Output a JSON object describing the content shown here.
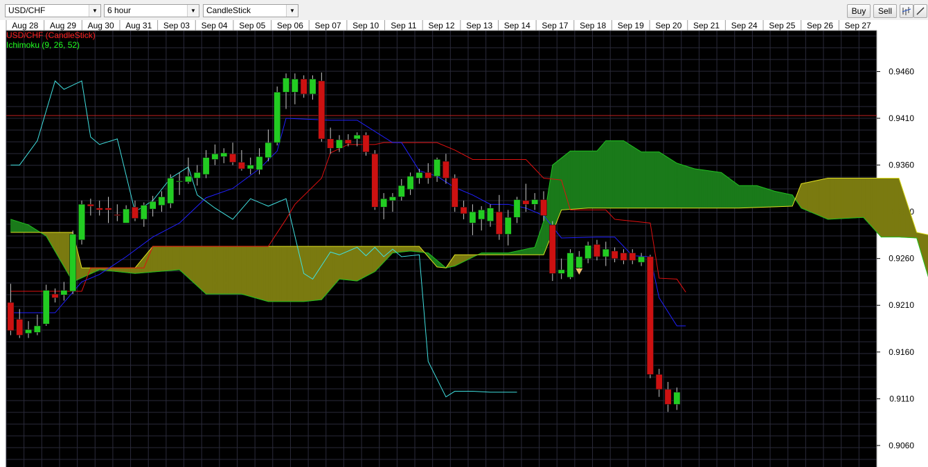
{
  "toolbar": {
    "symbol": "USD/CHF",
    "timeframe": "6 hour",
    "chart_type": "CandleStick",
    "buy_label": "Buy",
    "sell_label": "Sell",
    "icons": [
      "indicator-icon",
      "draw-line-icon"
    ]
  },
  "legend": {
    "main": "USD/CHF (CandleStick)",
    "main_color": "#ff2020",
    "indicator": "Ichimoku (9, 26, 52)",
    "indicator_color": "#20ff20"
  },
  "colors": {
    "background": "#000000",
    "grid": "#2a2a3a",
    "bull": "#22cc22",
    "bear": "#cc1111",
    "tenkan": "#2020ff",
    "kijun": "#e01010",
    "chikou": "#40e0e0",
    "span_a": "#20c020",
    "span_b": "#e0e020",
    "cloud_bull": "#1a7a1a",
    "cloud_bear": "#7a7a10",
    "hline": "#c02020"
  },
  "chart_data": {
    "type": "candlestick",
    "title": "",
    "x_labels": [
      "Aug 28",
      "Aug 29",
      "Aug 30",
      "Aug 31",
      "Sep 03",
      "Sep 04",
      "Sep 05",
      "Sep 06",
      "Sep 07",
      "Sep 10",
      "Sep 11",
      "Sep 12",
      "Sep 13",
      "Sep 14",
      "Sep 17",
      "Sep 18",
      "Sep 19",
      "Sep 20",
      "Sep 21",
      "Sep 24",
      "Sep 25",
      "Sep 26",
      "Sep 27"
    ],
    "y_ticks": [
      "0.9460",
      "0.9410",
      "0.9360",
      "0.9310",
      "0.9260",
      "0.9210",
      "0.9160",
      "0.9110",
      "0.9060"
    ],
    "ylim": [
      0.9037,
      0.9504
    ],
    "x_slots": 98,
    "horizontal_line": 0.9413,
    "candles": [
      {
        "o": 0.9213,
        "h": 0.9233,
        "l": 0.9178,
        "c": 0.9183
      },
      {
        "o": 0.9195,
        "h": 0.9206,
        "l": 0.9175,
        "c": 0.9178
      },
      {
        "o": 0.918,
        "h": 0.9193,
        "l": 0.9175,
        "c": 0.9184
      },
      {
        "o": 0.9181,
        "h": 0.92,
        "l": 0.9178,
        "c": 0.9188
      },
      {
        "o": 0.919,
        "h": 0.9232,
        "l": 0.9188,
        "c": 0.9226
      },
      {
        "o": 0.9222,
        "h": 0.9228,
        "l": 0.9213,
        "c": 0.9218
      },
      {
        "o": 0.9221,
        "h": 0.9235,
        "l": 0.9215,
        "c": 0.9226
      },
      {
        "o": 0.9225,
        "h": 0.929,
        "l": 0.9222,
        "c": 0.9286
      },
      {
        "o": 0.928,
        "h": 0.9322,
        "l": 0.9275,
        "c": 0.9318
      },
      {
        "o": 0.9318,
        "h": 0.9324,
        "l": 0.9306,
        "c": 0.9316
      },
      {
        "o": 0.9314,
        "h": 0.9322,
        "l": 0.9306,
        "c": 0.9312
      },
      {
        "o": 0.9314,
        "h": 0.9326,
        "l": 0.9298,
        "c": 0.9312
      },
      {
        "o": 0.9307,
        "h": 0.9318,
        "l": 0.93,
        "c": 0.9306
      },
      {
        "o": 0.9298,
        "h": 0.9317,
        "l": 0.9298,
        "c": 0.9313
      },
      {
        "o": 0.9315,
        "h": 0.9322,
        "l": 0.93,
        "c": 0.9303
      },
      {
        "o": 0.9302,
        "h": 0.932,
        "l": 0.9294,
        "c": 0.9317
      },
      {
        "o": 0.9313,
        "h": 0.9327,
        "l": 0.9305,
        "c": 0.9321
      },
      {
        "o": 0.9317,
        "h": 0.9332,
        "l": 0.931,
        "c": 0.9326
      },
      {
        "o": 0.9319,
        "h": 0.935,
        "l": 0.9314,
        "c": 0.9346
      },
      {
        "o": 0.9342,
        "h": 0.9352,
        "l": 0.9328,
        "c": 0.9343
      },
      {
        "o": 0.9342,
        "h": 0.9368,
        "l": 0.934,
        "c": 0.9348
      },
      {
        "o": 0.9346,
        "h": 0.936,
        "l": 0.9338,
        "c": 0.9352
      },
      {
        "o": 0.935,
        "h": 0.9376,
        "l": 0.9346,
        "c": 0.9368
      },
      {
        "o": 0.9366,
        "h": 0.9382,
        "l": 0.936,
        "c": 0.9372
      },
      {
        "o": 0.9369,
        "h": 0.9378,
        "l": 0.9362,
        "c": 0.9373
      },
      {
        "o": 0.9372,
        "h": 0.9384,
        "l": 0.936,
        "c": 0.9363
      },
      {
        "o": 0.9363,
        "h": 0.9376,
        "l": 0.9354,
        "c": 0.9356
      },
      {
        "o": 0.9356,
        "h": 0.9368,
        "l": 0.935,
        "c": 0.936
      },
      {
        "o": 0.9355,
        "h": 0.9378,
        "l": 0.935,
        "c": 0.9369
      },
      {
        "o": 0.9368,
        "h": 0.9398,
        "l": 0.9364,
        "c": 0.9384
      },
      {
        "o": 0.9384,
        "h": 0.9444,
        "l": 0.9381,
        "c": 0.9438
      },
      {
        "o": 0.9438,
        "h": 0.9458,
        "l": 0.942,
        "c": 0.9453
      },
      {
        "o": 0.9438,
        "h": 0.9458,
        "l": 0.9425,
        "c": 0.9452
      },
      {
        "o": 0.9452,
        "h": 0.9456,
        "l": 0.9432,
        "c": 0.9436
      },
      {
        "o": 0.9436,
        "h": 0.9456,
        "l": 0.943,
        "c": 0.9452
      },
      {
        "o": 0.945,
        "h": 0.9459,
        "l": 0.9385,
        "c": 0.9388
      },
      {
        "o": 0.9388,
        "h": 0.94,
        "l": 0.9372,
        "c": 0.9378
      },
      {
        "o": 0.9378,
        "h": 0.9392,
        "l": 0.9374,
        "c": 0.9387
      },
      {
        "o": 0.9387,
        "h": 0.9393,
        "l": 0.938,
        "c": 0.9383
      },
      {
        "o": 0.9388,
        "h": 0.9395,
        "l": 0.938,
        "c": 0.9392
      },
      {
        "o": 0.9392,
        "h": 0.9395,
        "l": 0.937,
        "c": 0.9374
      },
      {
        "o": 0.9372,
        "h": 0.9376,
        "l": 0.9312,
        "c": 0.9315
      },
      {
        "o": 0.9315,
        "h": 0.933,
        "l": 0.9302,
        "c": 0.9324
      },
      {
        "o": 0.9322,
        "h": 0.933,
        "l": 0.931,
        "c": 0.9326
      },
      {
        "o": 0.9326,
        "h": 0.9345,
        "l": 0.9322,
        "c": 0.9338
      },
      {
        "o": 0.9334,
        "h": 0.9352,
        "l": 0.9328,
        "c": 0.9348
      },
      {
        "o": 0.9346,
        "h": 0.9356,
        "l": 0.934,
        "c": 0.9352
      },
      {
        "o": 0.9352,
        "h": 0.9362,
        "l": 0.934,
        "c": 0.9346
      },
      {
        "o": 0.9348,
        "h": 0.9368,
        "l": 0.9342,
        "c": 0.9366
      },
      {
        "o": 0.9364,
        "h": 0.9372,
        "l": 0.934,
        "c": 0.9346
      },
      {
        "o": 0.9346,
        "h": 0.935,
        "l": 0.931,
        "c": 0.9315
      },
      {
        "o": 0.9315,
        "h": 0.9322,
        "l": 0.9302,
        "c": 0.9308
      },
      {
        "o": 0.9298,
        "h": 0.9318,
        "l": 0.9285,
        "c": 0.931
      },
      {
        "o": 0.9302,
        "h": 0.9316,
        "l": 0.929,
        "c": 0.9312
      },
      {
        "o": 0.93,
        "h": 0.9318,
        "l": 0.9294,
        "c": 0.9314
      },
      {
        "o": 0.931,
        "h": 0.9328,
        "l": 0.928,
        "c": 0.9286
      },
      {
        "o": 0.9286,
        "h": 0.9312,
        "l": 0.9274,
        "c": 0.9304
      },
      {
        "o": 0.9304,
        "h": 0.9326,
        "l": 0.9298,
        "c": 0.9323
      },
      {
        "o": 0.9322,
        "h": 0.934,
        "l": 0.931,
        "c": 0.9318
      },
      {
        "o": 0.9318,
        "h": 0.933,
        "l": 0.9312,
        "c": 0.9323
      },
      {
        "o": 0.9323,
        "h": 0.9332,
        "l": 0.93,
        "c": 0.9306
      },
      {
        "o": 0.9296,
        "h": 0.93,
        "l": 0.9236,
        "c": 0.9244
      },
      {
        "o": 0.9244,
        "h": 0.926,
        "l": 0.9238,
        "c": 0.9248
      },
      {
        "o": 0.924,
        "h": 0.927,
        "l": 0.9238,
        "c": 0.9266
      },
      {
        "o": 0.925,
        "h": 0.9268,
        "l": 0.9248,
        "c": 0.9262
      },
      {
        "o": 0.926,
        "h": 0.9278,
        "l": 0.9255,
        "c": 0.9274
      },
      {
        "o": 0.9275,
        "h": 0.928,
        "l": 0.9258,
        "c": 0.9262
      },
      {
        "o": 0.9262,
        "h": 0.9278,
        "l": 0.9252,
        "c": 0.927
      },
      {
        "o": 0.9268,
        "h": 0.9272,
        "l": 0.9256,
        "c": 0.926
      },
      {
        "o": 0.9266,
        "h": 0.927,
        "l": 0.9254,
        "c": 0.9258
      },
      {
        "o": 0.9266,
        "h": 0.927,
        "l": 0.9254,
        "c": 0.9258
      },
      {
        "o": 0.9256,
        "h": 0.9266,
        "l": 0.9252,
        "c": 0.9262
      },
      {
        "o": 0.9262,
        "h": 0.9264,
        "l": 0.9132,
        "c": 0.9136
      },
      {
        "o": 0.9136,
        "h": 0.9142,
        "l": 0.9112,
        "c": 0.912
      },
      {
        "o": 0.912,
        "h": 0.9128,
        "l": 0.9096,
        "c": 0.9104
      },
      {
        "o": 0.9104,
        "h": 0.9122,
        "l": 0.9098,
        "c": 0.9117
      }
    ],
    "tenkan": [
      [
        0,
        0.9202
      ],
      [
        5,
        0.9202
      ],
      [
        8,
        0.9235
      ],
      [
        10,
        0.9243
      ],
      [
        13,
        0.9262
      ],
      [
        16,
        0.9283
      ],
      [
        19,
        0.9298
      ],
      [
        22,
        0.9325
      ],
      [
        25,
        0.9335
      ],
      [
        28,
        0.9356
      ],
      [
        30,
        0.9375
      ],
      [
        31,
        0.941
      ],
      [
        36,
        0.9408
      ],
      [
        39,
        0.9408
      ],
      [
        41,
        0.9396
      ],
      [
        43,
        0.9384
      ],
      [
        44,
        0.9384
      ],
      [
        46,
        0.9354
      ],
      [
        48,
        0.9348
      ],
      [
        50,
        0.9336
      ],
      [
        52,
        0.9328
      ],
      [
        54,
        0.9318
      ],
      [
        56,
        0.9318
      ],
      [
        58,
        0.9314
      ],
      [
        60,
        0.9306
      ],
      [
        62,
        0.9282
      ],
      [
        66,
        0.9283
      ],
      [
        68,
        0.9283
      ],
      [
        70,
        0.9263
      ],
      [
        72,
        0.9262
      ],
      [
        73,
        0.9218
      ],
      [
        75,
        0.9188
      ],
      [
        76,
        0.9188
      ]
    ],
    "kijun": [
      [
        0,
        0.9225
      ],
      [
        8,
        0.9225
      ],
      [
        9,
        0.925
      ],
      [
        15,
        0.925
      ],
      [
        16,
        0.9273
      ],
      [
        29,
        0.9273
      ],
      [
        31,
        0.9302
      ],
      [
        32,
        0.9318
      ],
      [
        35,
        0.9346
      ],
      [
        36,
        0.9373
      ],
      [
        38,
        0.9382
      ],
      [
        41,
        0.9382
      ],
      [
        42,
        0.9384
      ],
      [
        48,
        0.9384
      ],
      [
        50,
        0.9376
      ],
      [
        52,
        0.9366
      ],
      [
        58,
        0.9366
      ],
      [
        60,
        0.9346
      ],
      [
        62,
        0.9344
      ],
      [
        63,
        0.9312
      ],
      [
        67,
        0.9312
      ],
      [
        68,
        0.9302
      ],
      [
        72,
        0.9298
      ],
      [
        73,
        0.9239
      ],
      [
        75,
        0.9238
      ],
      [
        76,
        0.9224
      ]
    ],
    "chikou": [
      [
        0,
        0.936
      ],
      [
        1,
        0.936
      ],
      [
        3,
        0.9386
      ],
      [
        5,
        0.945
      ],
      [
        6,
        0.9441
      ],
      [
        8,
        0.945
      ],
      [
        9,
        0.939
      ],
      [
        10,
        0.9382
      ],
      [
        12,
        0.9388
      ],
      [
        14,
        0.931
      ],
      [
        16,
        0.9322
      ],
      [
        18,
        0.9346
      ],
      [
        20,
        0.9358
      ],
      [
        21,
        0.9328
      ],
      [
        23,
        0.9314
      ],
      [
        25,
        0.9302
      ],
      [
        27,
        0.9324
      ],
      [
        29,
        0.9316
      ],
      [
        31,
        0.9324
      ],
      [
        33,
        0.9244
      ],
      [
        34,
        0.9238
      ],
      [
        36,
        0.9267
      ],
      [
        37,
        0.9264
      ],
      [
        39,
        0.9272
      ],
      [
        40,
        0.9263
      ],
      [
        41,
        0.9272
      ],
      [
        42,
        0.9262
      ],
      [
        43,
        0.927
      ],
      [
        44,
        0.9262
      ],
      [
        46,
        0.9264
      ],
      [
        47,
        0.915
      ],
      [
        49,
        0.9112
      ],
      [
        50,
        0.9118
      ],
      [
        52,
        0.9118
      ],
      [
        54,
        0.9117
      ],
      [
        57,
        0.9117
      ]
    ],
    "span_a": [
      [
        0,
        0.9302
      ],
      [
        2,
        0.9296
      ],
      [
        4,
        0.9284
      ],
      [
        7,
        0.9235
      ],
      [
        10,
        0.9248
      ],
      [
        14,
        0.9244
      ],
      [
        19,
        0.9248
      ],
      [
        22,
        0.9222
      ],
      [
        26,
        0.9222
      ],
      [
        29,
        0.9214
      ],
      [
        33,
        0.9214
      ],
      [
        35,
        0.9216
      ],
      [
        37,
        0.9238
      ],
      [
        39,
        0.9236
      ],
      [
        41,
        0.9246
      ],
      [
        43,
        0.9266
      ],
      [
        45,
        0.9268
      ],
      [
        47,
        0.9266
      ],
      [
        49,
        0.925
      ],
      [
        50,
        0.9252
      ],
      [
        53,
        0.9266
      ],
      [
        56,
        0.9266
      ],
      [
        59,
        0.9272
      ],
      [
        60,
        0.93
      ],
      [
        61,
        0.936
      ],
      [
        63,
        0.9375
      ],
      [
        66,
        0.9375
      ],
      [
        67,
        0.9386
      ],
      [
        69,
        0.9386
      ],
      [
        71,
        0.9374
      ],
      [
        73,
        0.9374
      ],
      [
        75,
        0.9362
      ],
      [
        77,
        0.9356
      ],
      [
        80,
        0.9352
      ],
      [
        82,
        0.9338
      ],
      [
        84,
        0.9338
      ],
      [
        86,
        0.9332
      ],
      [
        88,
        0.9328
      ],
      [
        89,
        0.9314
      ],
      [
        91,
        0.9306
      ],
      [
        92,
        0.9302
      ],
      [
        96,
        0.9304
      ],
      [
        98,
        0.9283
      ],
      [
        100,
        0.9283
      ],
      [
        102,
        0.9282
      ],
      [
        104,
        0.9218
      ],
      [
        106,
        0.9208
      ]
    ],
    "span_b": [
      [
        0,
        0.9288
      ],
      [
        4,
        0.9288
      ],
      [
        5,
        0.9288
      ],
      [
        7,
        0.9288
      ],
      [
        8,
        0.925
      ],
      [
        14,
        0.925
      ],
      [
        16,
        0.9273
      ],
      [
        29,
        0.9273
      ],
      [
        45,
        0.9273
      ],
      [
        46,
        0.9273
      ],
      [
        48,
        0.9251
      ],
      [
        49,
        0.925
      ],
      [
        50,
        0.9264
      ],
      [
        54,
        0.9264
      ],
      [
        55,
        0.9264
      ],
      [
        60,
        0.9264
      ],
      [
        62,
        0.9312
      ],
      [
        65,
        0.9314
      ],
      [
        82,
        0.9314
      ],
      [
        88,
        0.9316
      ],
      [
        89,
        0.934
      ],
      [
        92,
        0.9346
      ],
      [
        98,
        0.9346
      ],
      [
        100,
        0.9346
      ],
      [
        102,
        0.9288
      ],
      [
        106,
        0.928
      ]
    ],
    "down_marker": {
      "slot": 64,
      "price": 0.9245
    }
  }
}
